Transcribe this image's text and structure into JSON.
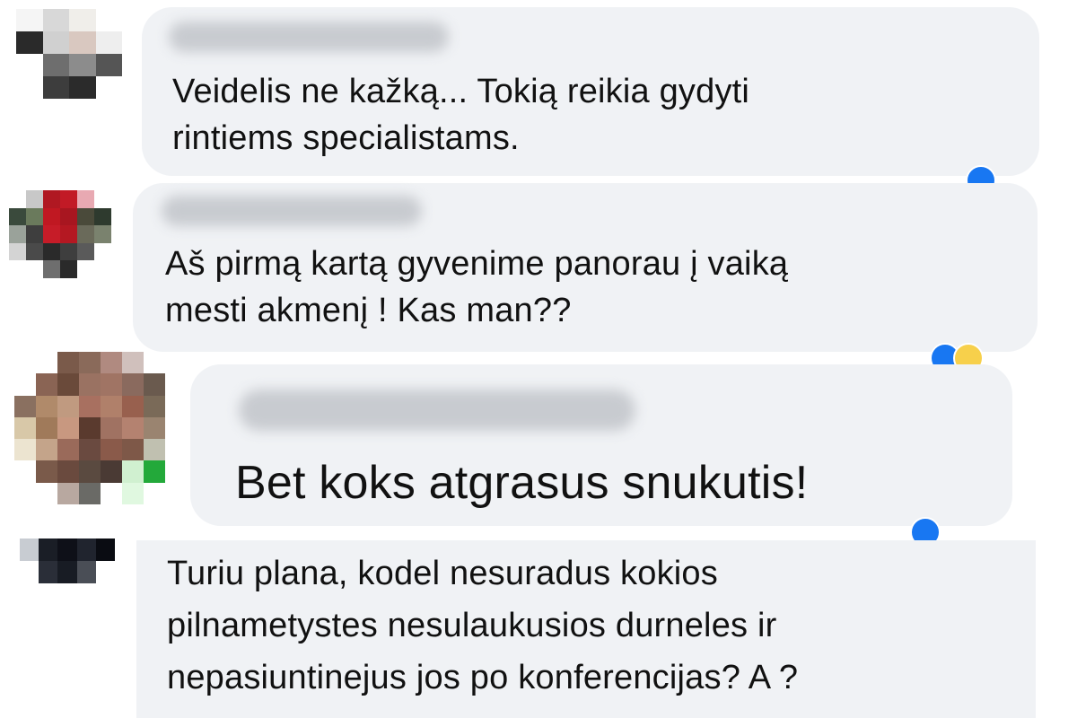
{
  "comments": [
    {
      "author": "",
      "text_lines": [
        "Veidelis ne kažką... Tokią reikia gydyti",
        "rintiems specialistams."
      ]
    },
    {
      "author": "",
      "text_lines": [
        "Aš pirmą kartą gyvenime panorau į vaiką",
        "mesti akmenį ! Kas man??"
      ]
    },
    {
      "author": "",
      "text_lines": [
        "Bet koks atgrasus snukutis!"
      ]
    },
    {
      "author": "",
      "text_lines": [
        "Turiu plana, kodel nesuradus kokios",
        "pilnametystes nesulaukusios durneles ir",
        "nepasiuntinejus jos po konferencijas? A ?"
      ]
    }
  ],
  "reactions": [
    "like-reaction-icon",
    "haha-reaction-icon"
  ],
  "colors": {
    "bubble": "#f0f2f5",
    "like_blue": "#1877f2",
    "haha_yellow": "#f7d04b",
    "online_green": "#23a93a"
  }
}
